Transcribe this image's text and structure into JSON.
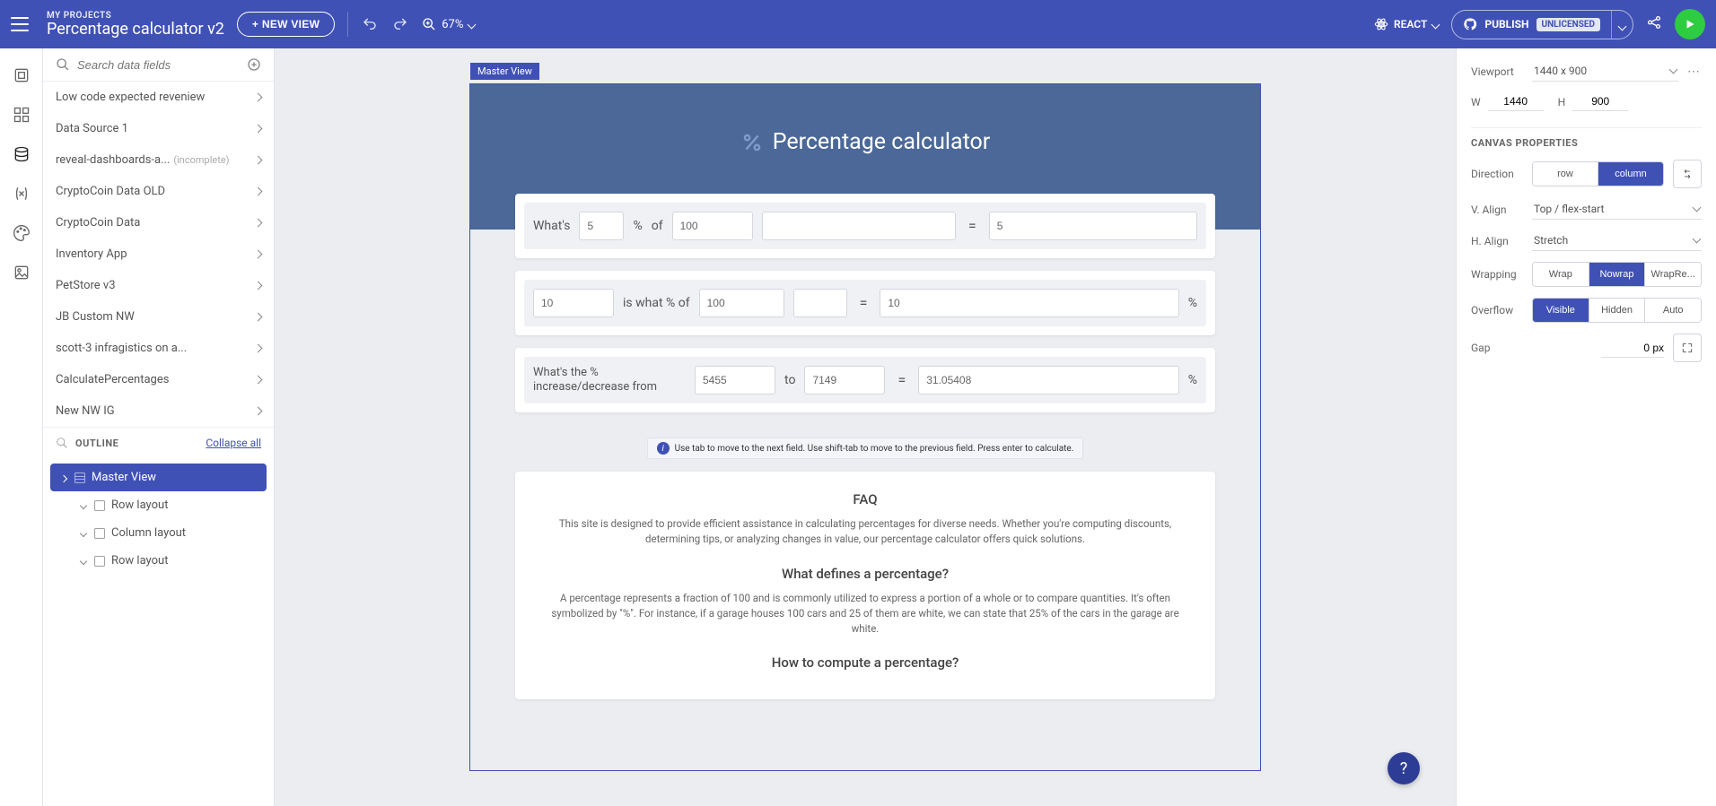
{
  "header": {
    "projects_label": "MY PROJECTS",
    "project_title": "Percentage calculator v2",
    "new_view": "+ NEW VIEW",
    "zoom": "67%",
    "framework": "REACT",
    "publish": "PUBLISH",
    "license_badge": "UNLICENSED"
  },
  "sidebar": {
    "search_placeholder": "Search data fields",
    "datasources": [
      {
        "name": "Low code expected reveniew"
      },
      {
        "name": "Data Source 1"
      },
      {
        "name": "reveal-dashboards-a...",
        "suffix": "(incomplete)"
      },
      {
        "name": "CryptoCoin Data OLD"
      },
      {
        "name": "CryptoCoin Data"
      },
      {
        "name": "Inventory App"
      },
      {
        "name": "PetStore v3"
      },
      {
        "name": "JB Custom NW"
      },
      {
        "name": "scott-3 infragistics on a..."
      },
      {
        "name": "CalculatePercentages"
      },
      {
        "name": "New NW IG"
      }
    ],
    "outline_label": "OUTLINE",
    "collapse_label": "Collapse all",
    "tree": {
      "root": "Master View",
      "children": [
        "Row layout",
        "Column layout",
        "Row layout"
      ]
    }
  },
  "canvas": {
    "selection_label": "Master View",
    "page_title": "Percentage calculator",
    "row1": {
      "label": "What's",
      "v1": "5",
      "sym1": "%",
      "mid": "of",
      "v2": "100",
      "eq": "=",
      "res": "5"
    },
    "row2": {
      "v1": "10",
      "mid": "is what % of",
      "v2": "100",
      "eq": "=",
      "res": "10",
      "sym2": "%"
    },
    "row3": {
      "label": "What's the % increase/decrease from",
      "v1": "5455",
      "mid": "to",
      "v2": "7149",
      "eq": "=",
      "res": "31.05408",
      "sym2": "%"
    },
    "helper_text": "Use tab to move to the next field. Use shift-tab to move to the previous field. Press enter to calculate.",
    "faq": {
      "h1": "FAQ",
      "p1": "This site is designed to provide efficient assistance in calculating percentages for diverse needs. Whether you're computing discounts, determining tips, or analyzing changes in value, our percentage calculator offers quick solutions.",
      "h2": "What defines a percentage?",
      "p2": "A percentage represents a fraction of 100 and is commonly utilized to express a portion of a whole or to compare quantities. It's often symbolized by \"%\". For instance, if a garage houses 100 cars and 25 of them are white, we can state that 25% of the cars in the garage are white.",
      "h3": "How to compute a percentage?"
    }
  },
  "props": {
    "viewport_label": "Viewport",
    "viewport_value": "1440 x 900",
    "w": "1440",
    "h": "900",
    "section": "CANVAS PROPERTIES",
    "direction_label": "Direction",
    "direction_opts": [
      "row",
      "column"
    ],
    "valign_label": "V. Align",
    "valign_value": "Top / flex-start",
    "halign_label": "H. Align",
    "halign_value": "Stretch",
    "wrap_label": "Wrapping",
    "wrap_opts": [
      "Wrap",
      "Nowrap",
      "WrapRe..."
    ],
    "overflow_label": "Overflow",
    "overflow_opts": [
      "Visible",
      "Hidden",
      "Auto"
    ],
    "gap_label": "Gap",
    "gap_value": "0 px"
  },
  "fab": "?"
}
